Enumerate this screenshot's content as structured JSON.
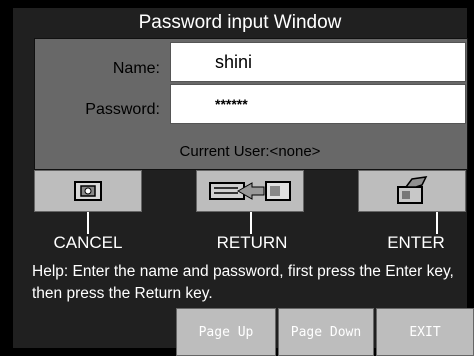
{
  "window": {
    "title": "Password input Window"
  },
  "form": {
    "name_label": "Name:",
    "name_value": "shini",
    "password_label": "Password:",
    "password_value": "******",
    "current_user": "Current User:<none>"
  },
  "buttons": {
    "cancel_label": "CANCEL",
    "return_label": "RETURN",
    "enter_label": "ENTER"
  },
  "help_text": "Help: Enter the name and password, first press the Enter key, then press the Return key.",
  "footer": {
    "page_up": "Page Up",
    "page_down": "Page Down",
    "exit": "EXIT"
  },
  "colors": {
    "panel": "#686868",
    "button": "#bdbdbd",
    "background": "#000000"
  }
}
